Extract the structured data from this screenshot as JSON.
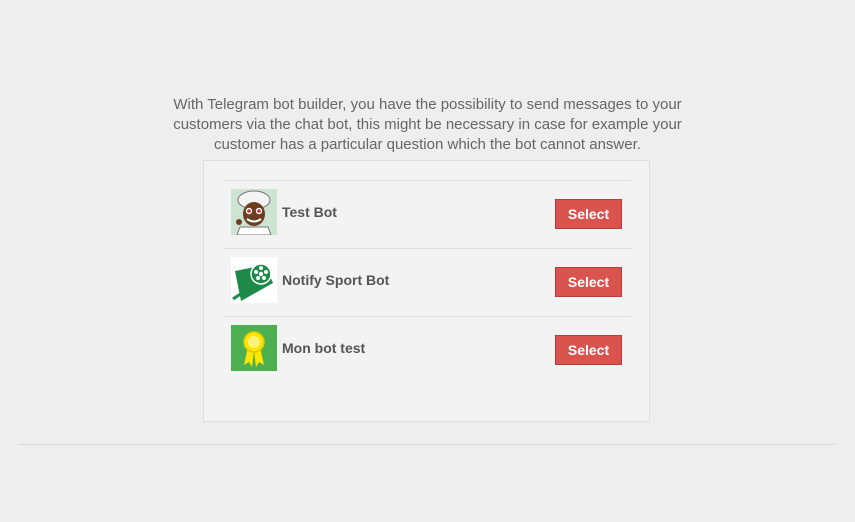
{
  "intro_text": "With Telegram bot builder, you have the possibility to send messages to your customers via the chat bot, this might be necessary in case for example your customer has a particular question which the bot cannot answer.",
  "bots": [
    {
      "name": "Test Bot",
      "select_label": "Select",
      "avatar_icon": "chef-cartoon-icon"
    },
    {
      "name": "Notify Sport Bot",
      "select_label": "Select",
      "avatar_icon": "sport-ball-icon"
    },
    {
      "name": "Mon bot test",
      "select_label": "Select",
      "avatar_icon": "award-ribbon-icon"
    }
  ],
  "colors": {
    "page_background": "#eeeeee",
    "panel_background": "#f3f3f3",
    "select_button": "#d9534f",
    "text_gray": "#666666"
  }
}
